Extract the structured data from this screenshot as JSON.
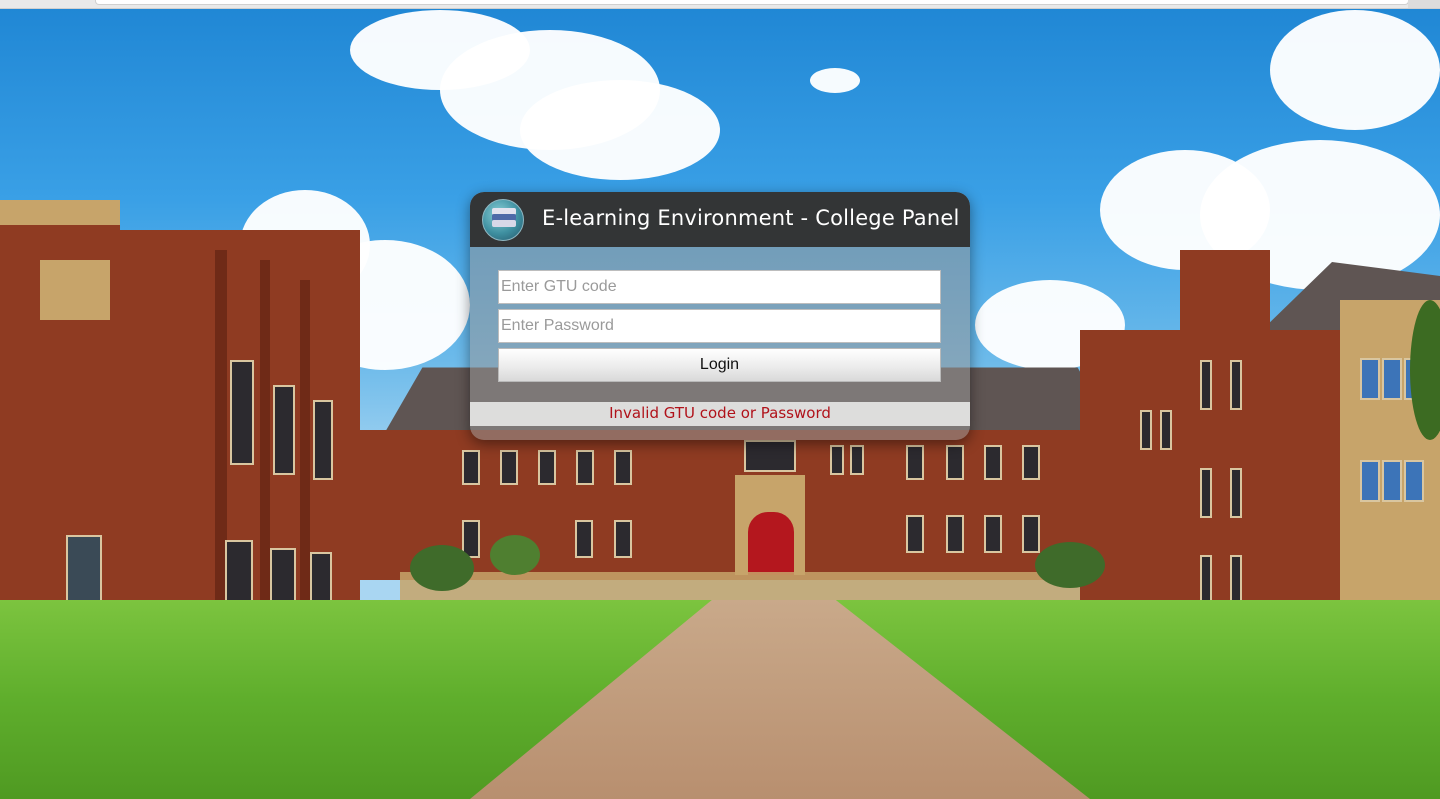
{
  "login_panel": {
    "title": "E-learning Environment - College Panel",
    "logo_icon": "books-logo-icon",
    "gtu_input": {
      "value": "",
      "placeholder": "Enter GTU code"
    },
    "password_input": {
      "value": "",
      "placeholder": "Enter Password"
    },
    "login_label": "Login",
    "error_message": "Invalid GTU code or Password"
  },
  "colors": {
    "header_bg": "#333536",
    "error_text": "#b0121a",
    "sky": "#3aa0e6",
    "lawn": "#5fae2c",
    "brick": "#8f3b22"
  }
}
